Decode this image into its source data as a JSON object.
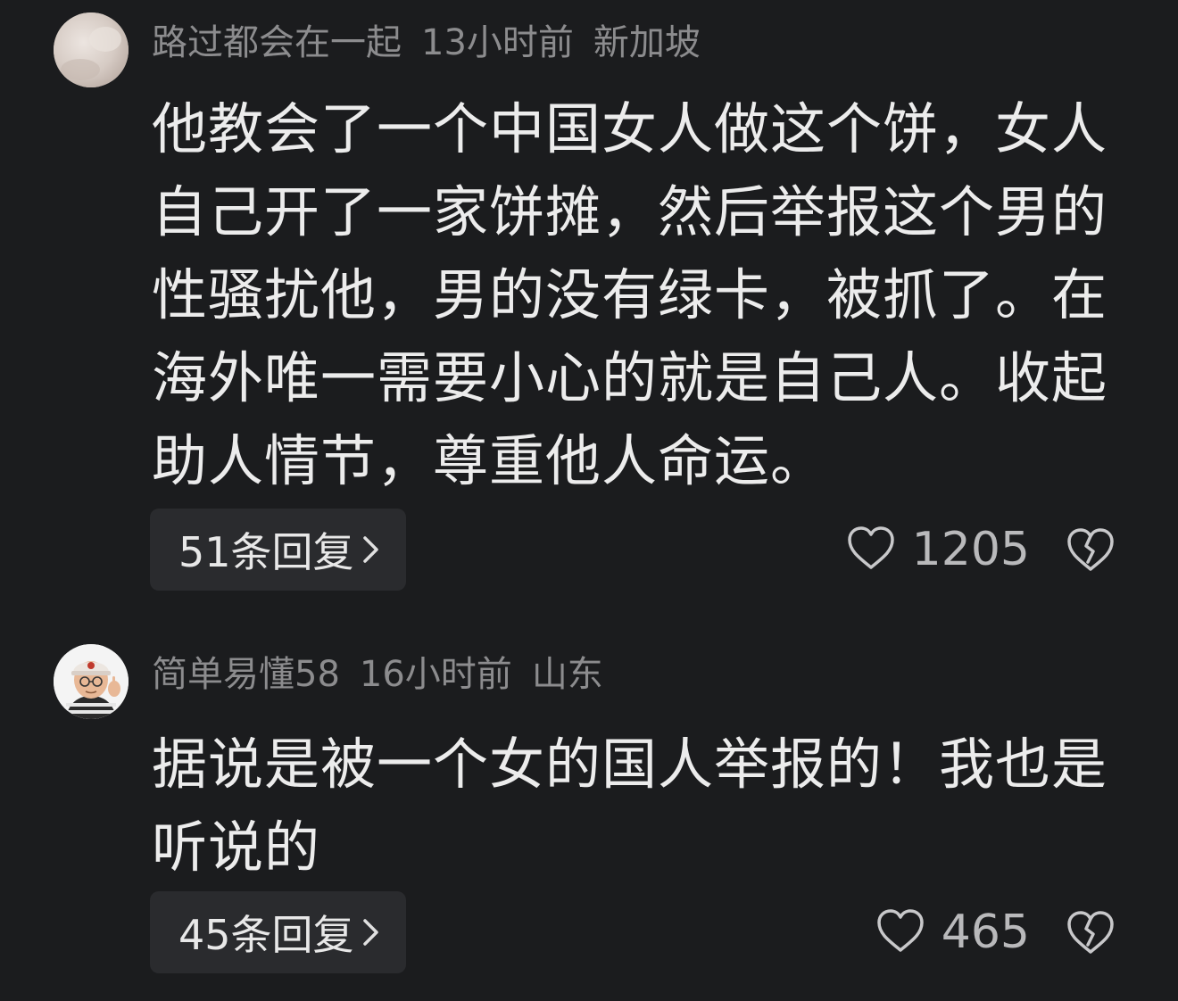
{
  "comments": [
    {
      "username": "路过都会在一起",
      "time": "13小时前",
      "location": "新加坡",
      "text": "他教会了一个中国女人做这个饼，女人自己开了一家饼摊，然后举报这个男的性骚扰他，男的没有绿卡，被抓了。在海外唯一需要小心的就是自己人。收起助人情节，尊重他人命运。",
      "replies_label": "51条回复",
      "likes": "1205"
    },
    {
      "username": "简单易懂58",
      "time": "16小时前",
      "location": "山东",
      "text": "据说是被一个女的国人举报的！我也是听说的",
      "replies_label": "45条回复",
      "likes": "465"
    }
  ],
  "colors": {
    "background": "#1b1c1e",
    "meta_text": "#8c8c8e",
    "body_text": "#ececec",
    "reply_button_bg": "#2a2b2e",
    "icon": "#c8c8ca"
  },
  "icons": {
    "reply_chevron": "chevron-right-icon",
    "like": "heart-outline-icon",
    "dislike": "broken-heart-icon"
  }
}
